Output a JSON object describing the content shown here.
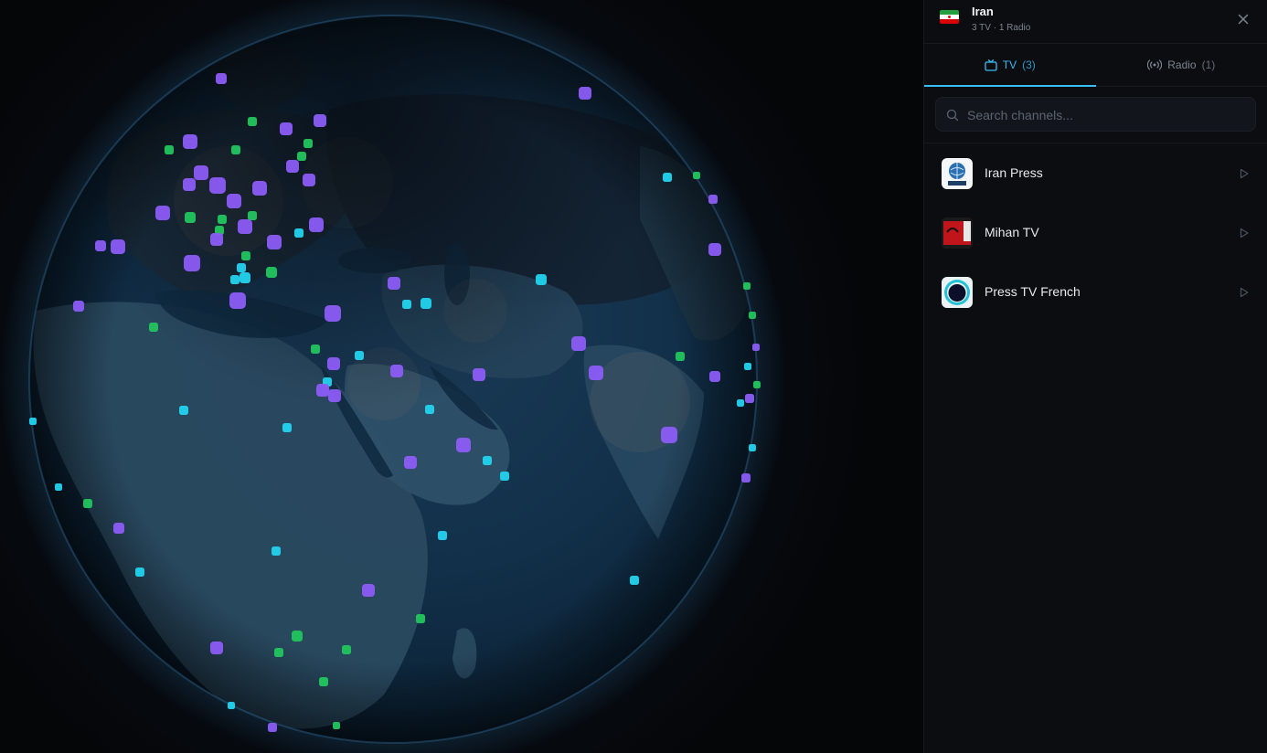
{
  "country": {
    "name": "Iran",
    "summary": "3 TV · 1 Radio",
    "flag_colors": [
      "#239f40",
      "#ffffff",
      "#da0000"
    ]
  },
  "tabs": [
    {
      "label": "TV",
      "count": "(3)",
      "icon": "tv-icon",
      "active": true
    },
    {
      "label": "Radio",
      "count": "(1)",
      "icon": "radio-icon",
      "active": false
    }
  ],
  "search": {
    "placeholder": "Search channels...",
    "value": ""
  },
  "channels": [
    {
      "name": "Iran Press",
      "logo": "iran-press-logo"
    },
    {
      "name": "Mihan TV",
      "logo": "mihan-tv-logo"
    },
    {
      "name": "Press TV French",
      "logo": "press-tv-french-logo"
    }
  ],
  "colors": {
    "accent": "#38bdf8",
    "marker_tv": "#8b5cf6",
    "marker_radio": "#22c55e",
    "marker_stream": "#22d3ee"
  }
}
